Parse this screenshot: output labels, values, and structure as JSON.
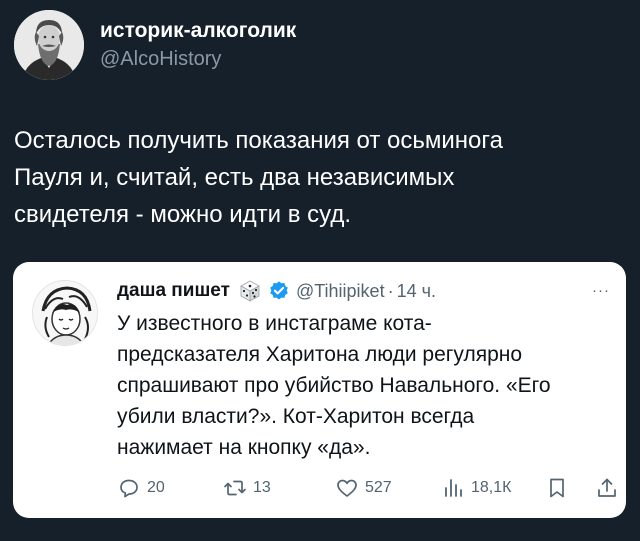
{
  "tweet": {
    "author_name": "историк-алкоголик",
    "author_handle": "@AlcoHistory",
    "text": "Осталось получить показания от осьминога\nПауля и, считай, есть два независимых\nсвидетеля - можно идти в суд."
  },
  "quoted": {
    "author_name": "даша пишет",
    "author_handle": "@Tihiipiket",
    "separator": "·",
    "time": "14 ч.",
    "more_label": "···",
    "text": "У известного в инстаграме кота-\nпредсказателя Харитона люди регулярно\nспрашивают про убийство Навального. «Его\nубили власти?». Кот-Харитон всегда\nнажимает на кнопку «да».",
    "stats": {
      "replies": "20",
      "retweets": "13",
      "likes": "527",
      "views": "18,1К"
    }
  },
  "colors": {
    "background": "#15202b",
    "verified": "#1d9bf0",
    "muted": "#536471"
  },
  "icons": [
    "portrait-avatar",
    "sketch-avatar",
    "dice-icon",
    "verified-icon",
    "reply-icon",
    "retweet-icon",
    "like-icon",
    "views-icon",
    "bookmark-icon",
    "share-icon"
  ]
}
